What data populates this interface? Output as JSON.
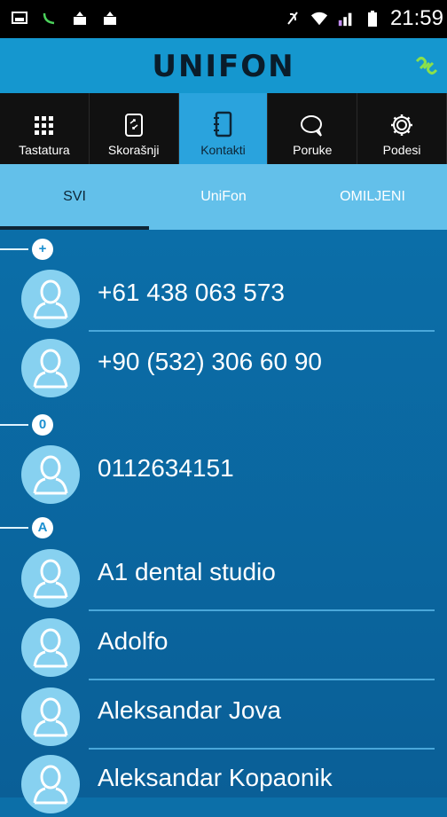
{
  "status": {
    "time": "21:59"
  },
  "app": {
    "title": "UNIFON"
  },
  "nav": [
    {
      "label": "Tastatura",
      "icon": "dialpad-icon"
    },
    {
      "label": "Skorašnji",
      "icon": "recent-calls-icon"
    },
    {
      "label": "Kontakti",
      "icon": "contacts-book-icon",
      "active": true
    },
    {
      "label": "Poruke",
      "icon": "message-bubble-icon"
    },
    {
      "label": "Podesi",
      "icon": "gear-icon"
    }
  ],
  "tabs": [
    {
      "label": "SVI",
      "active": true
    },
    {
      "label": "UniFon"
    },
    {
      "label": "OMILJENI"
    }
  ],
  "sections": [
    {
      "label": "+",
      "contacts": [
        "+61 438 063 573",
        "+90 (532) 306 60 90"
      ]
    },
    {
      "label": "0",
      "contacts": [
        "0112634151"
      ]
    },
    {
      "label": "A",
      "contacts": [
        "A1 dental studio",
        "Adolfo",
        "Aleksandar Jova",
        "Aleksandar Kopaonik"
      ]
    }
  ],
  "colors": {
    "appbar": "#1597cf",
    "tabs": "#63c0ea",
    "list": "#0b6ea8",
    "accent": "#8ce04a"
  }
}
